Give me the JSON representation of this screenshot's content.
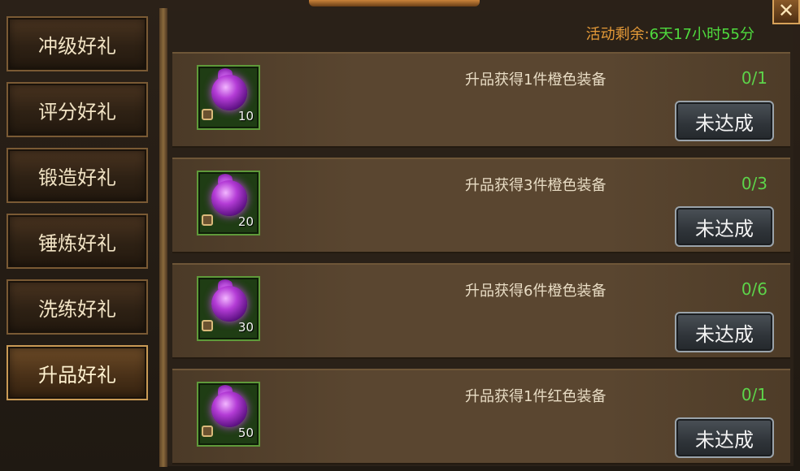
{
  "sidebar": {
    "items": [
      {
        "label": "冲级好礼",
        "active": false
      },
      {
        "label": "评分好礼",
        "active": false
      },
      {
        "label": "锻造好礼",
        "active": false
      },
      {
        "label": "锤炼好礼",
        "active": false
      },
      {
        "label": "洗练好礼",
        "active": false
      },
      {
        "label": "升品好礼",
        "active": true
      }
    ]
  },
  "header": {
    "remaining_label": "活动剩余:",
    "remaining_time": "6天17小时55分",
    "close_glyph": "✕"
  },
  "tasks": [
    {
      "icon": "purple-orb-icon",
      "count": "10",
      "text": "升品获得1件橙色装备",
      "progress": "0/1",
      "status": "未达成"
    },
    {
      "icon": "purple-orb-icon",
      "count": "20",
      "text": "升品获得3件橙色装备",
      "progress": "0/3",
      "status": "未达成"
    },
    {
      "icon": "purple-orb-icon",
      "count": "30",
      "text": "升品获得6件橙色装备",
      "progress": "0/6",
      "status": "未达成"
    },
    {
      "icon": "purple-orb-icon",
      "count": "50",
      "text": "升品获得1件红色装备",
      "progress": "0/1",
      "status": "未达成"
    }
  ],
  "colors": {
    "accent_orange": "#e59a38",
    "accent_green": "#4fdc3e",
    "progress_green": "#5dd44a"
  }
}
